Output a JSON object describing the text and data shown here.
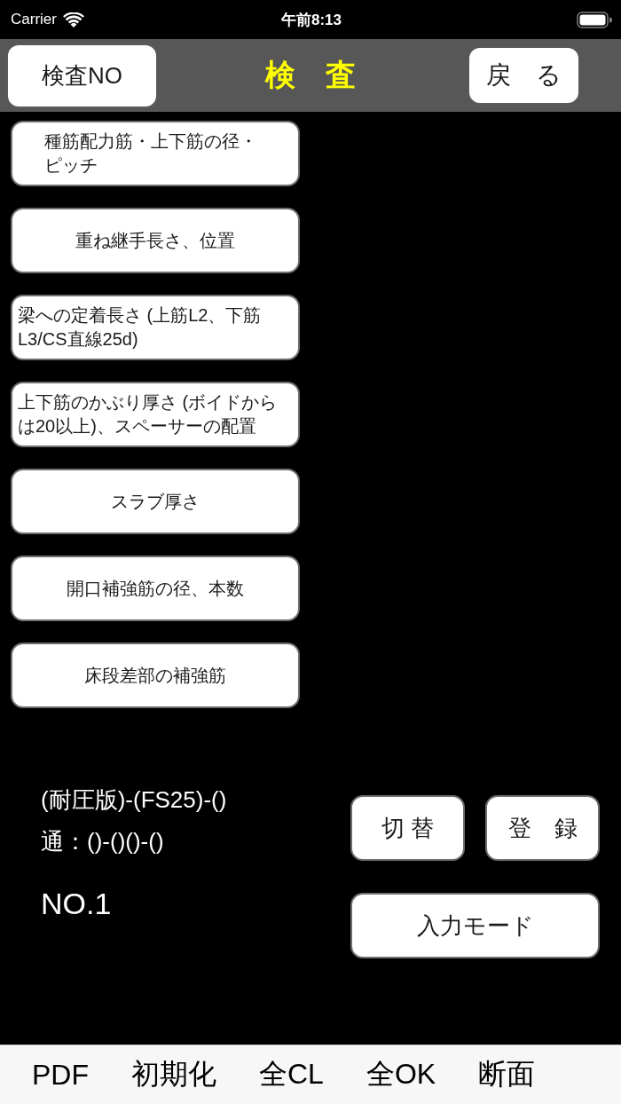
{
  "status_bar": {
    "carrier": "Carrier",
    "time": "午前8:13"
  },
  "nav_bar": {
    "left_button": "検査NO",
    "title": "検　査",
    "right_button": "戻　る"
  },
  "check_items": [
    {
      "label": "種筋配力筋・上下筋の径・ピッチ"
    },
    {
      "label": "重ね継手長さ、位置"
    },
    {
      "label": "梁への定着長さ (上筋L2、下筋L3/CS直線25d)"
    },
    {
      "label": "上下筋のかぶり厚さ (ボイドからは20以上)、スペーサーの配置"
    },
    {
      "label": "スラブ厚さ"
    },
    {
      "label": "開口補強筋の径、本数"
    },
    {
      "label": "床段差部の補強筋"
    }
  ],
  "info": {
    "line_1": "(耐圧版)-(FS25)-()",
    "line_2": "通：()-()()-()",
    "number": "NO.1"
  },
  "actions": [
    {
      "label": "切 替"
    },
    {
      "label": "登　録"
    },
    {
      "label": "入力モード"
    }
  ],
  "toolbar": [
    "PDF",
    "初期化",
    "全CL",
    "全OK",
    "断面"
  ]
}
